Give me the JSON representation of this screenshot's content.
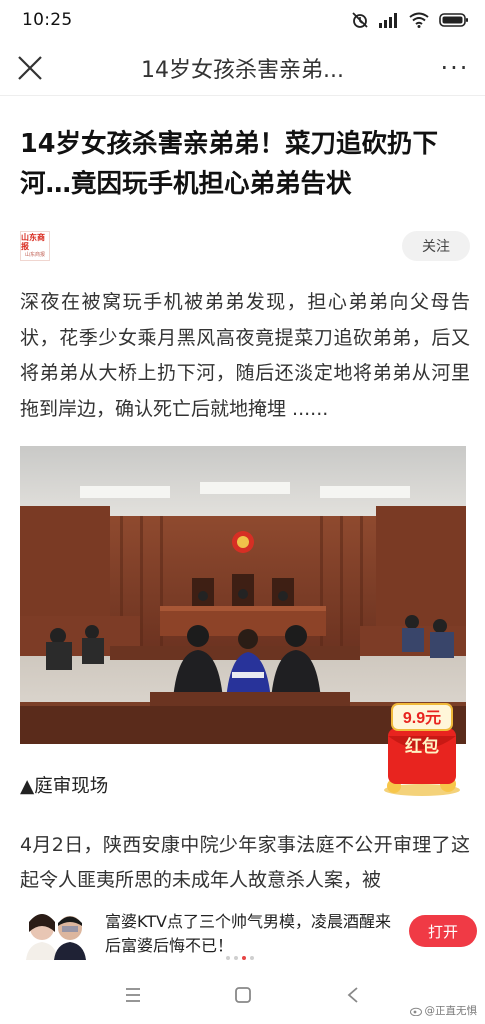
{
  "status_bar": {
    "time": "10:25",
    "icons": [
      "alarm-off-icon",
      "signal-icon",
      "wifi-icon",
      "battery-icon"
    ]
  },
  "nav": {
    "title": "14岁女孩杀害亲弟...",
    "close_icon": "close-icon",
    "more_label": "···"
  },
  "article": {
    "headline": "14岁女孩杀害亲弟弟！菜刀追砍扔下河…竟因玩手机担心弟弟告状",
    "source": {
      "logo_text": "山东商报",
      "logo_subtext": "山东商报",
      "follow_label": "关注"
    },
    "lead": "深夜在被窝玩手机被弟弟发现，担心弟弟向父母告状，花季少女乘月黑风高夜竟提菜刀追砍弟弟，后又将弟弟从大桥上扔下河，随后还淡定地将弟弟从河里拖到岸边，确认死亡后就地掩埋 ......",
    "photo_caption": "▲庭审现场",
    "body": "4月2日，陕西安康中院少年家事法庭不公开审理了这起令人匪夷所思的未成年人故意杀人案，被"
  },
  "red_envelope": {
    "amount": "9.9元",
    "label": "红包"
  },
  "ad": {
    "text": "富婆KTV点了三个帅气男模，凌晨酒醒来后富婆后悔不已！",
    "open_label": "打开",
    "dots_count": 4,
    "active_dot": 2
  },
  "watermark": "@正直无惧",
  "colors": {
    "accent_red": "#f03a45",
    "follow_bg": "#f1f1f1",
    "envelope_red": "#e8241f",
    "envelope_gold": "#f7c64a"
  }
}
